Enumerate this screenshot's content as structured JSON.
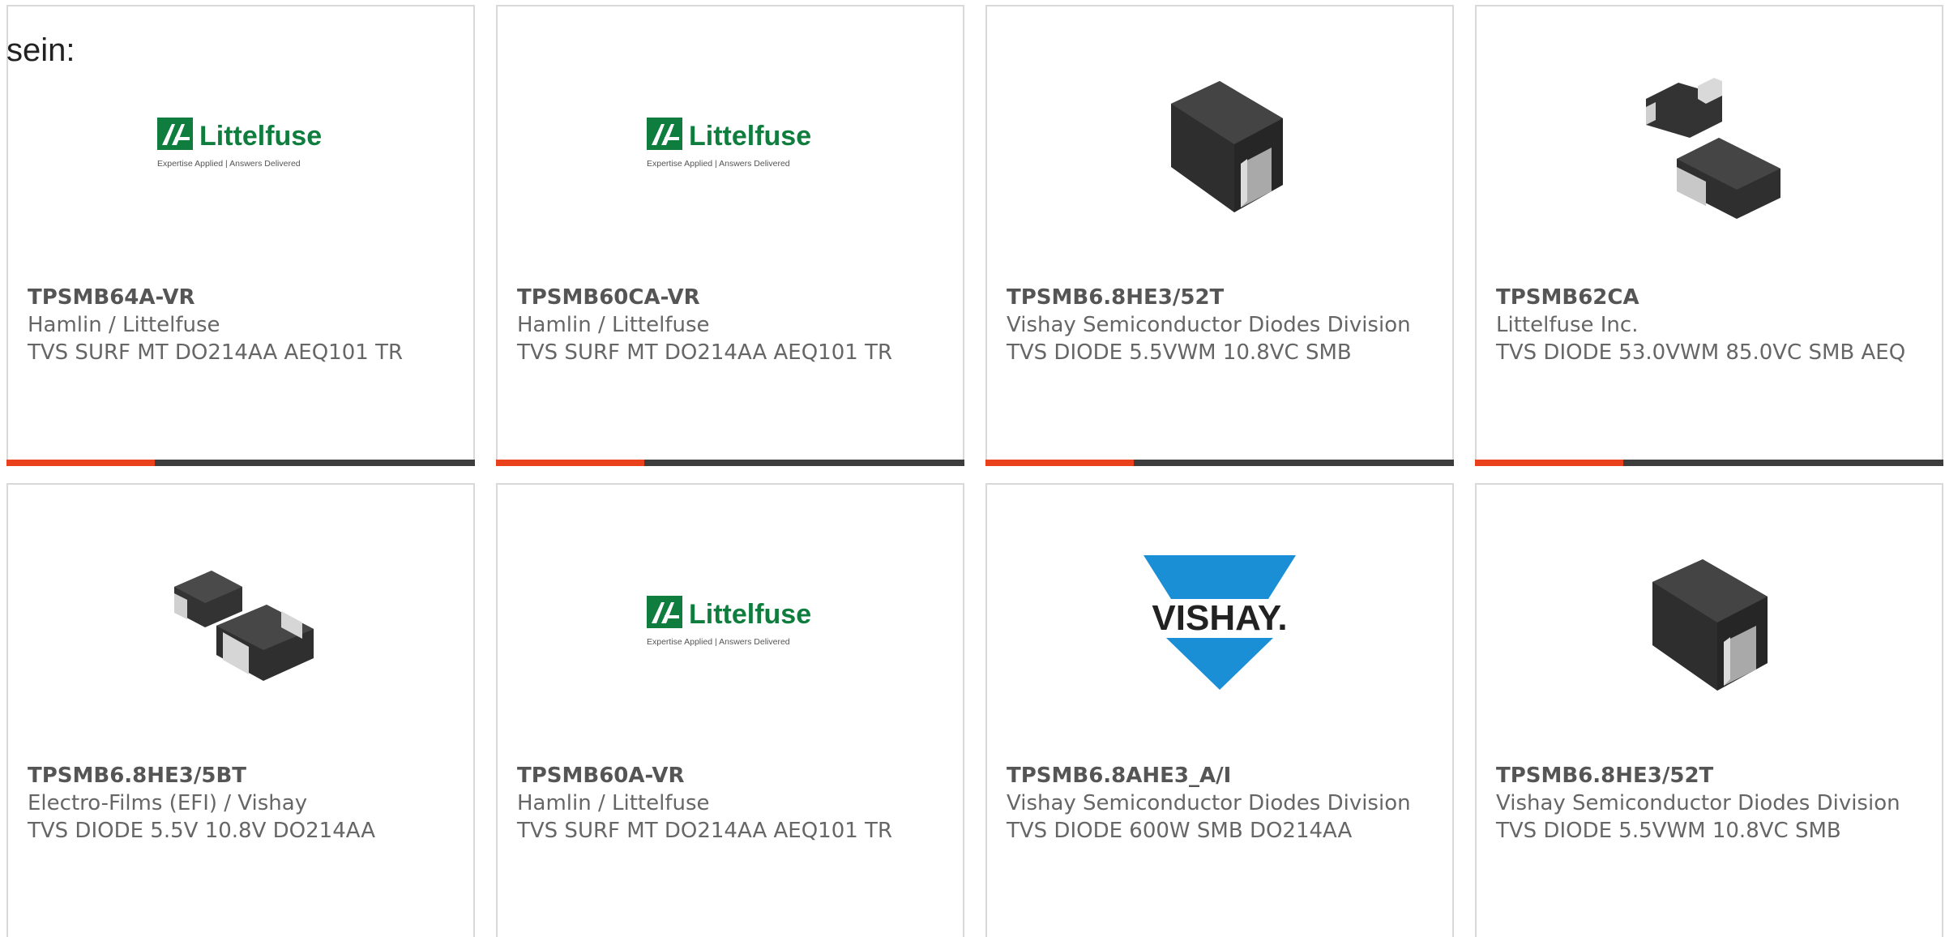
{
  "intro_text": "sein:",
  "colors": {
    "accent_orange": "#e8411b",
    "accent_dark": "#3d3d3d",
    "littelfuse_green": "#0f7d3e",
    "vishay_blue": "#1a8fd6"
  },
  "products": [
    {
      "part_number": "TPSMB64A-VR",
      "manufacturer": "Hamlin / Littelfuse",
      "description": "TVS SURF MT DO214AA AEQ101 TR",
      "image": "littelfuse-logo",
      "logo_text": "Littelfuse",
      "logo_tagline": "Expertise Applied | Answers Delivered"
    },
    {
      "part_number": "TPSMB60CA-VR",
      "manufacturer": "Hamlin / Littelfuse",
      "description": "TVS SURF MT DO214AA AEQ101 TR",
      "image": "littelfuse-logo",
      "logo_text": "Littelfuse",
      "logo_tagline": "Expertise Applied | Answers Delivered"
    },
    {
      "part_number": "TPSMB6.8HE3/52T",
      "manufacturer": "Vishay Semiconductor Diodes Division",
      "description": "TVS DIODE 5.5VWM 10.8VC SMB",
      "image": "smb-diode-package"
    },
    {
      "part_number": "TPSMB62CA",
      "manufacturer": "Littelfuse Inc.",
      "description": "TVS DIODE 53.0VWM 85.0VC SMB AEQ",
      "image": "smb-diode-pair"
    },
    {
      "part_number": "TPSMB6.8HE3/5BT",
      "manufacturer": "Electro-Films (EFI) / Vishay",
      "description": "TVS DIODE 5.5V 10.8V DO214AA",
      "image": "smb-diode-pair-flat"
    },
    {
      "part_number": "TPSMB60A-VR",
      "manufacturer": "Hamlin / Littelfuse",
      "description": "TVS SURF MT DO214AA AEQ101 TR",
      "image": "littelfuse-logo",
      "logo_text": "Littelfuse",
      "logo_tagline": "Expertise Applied | Answers Delivered"
    },
    {
      "part_number": "TPSMB6.8AHE3_A/I",
      "manufacturer": "Vishay Semiconductor Diodes Division",
      "description": "TVS DIODE 600W SMB DO214AA",
      "image": "vishay-logo",
      "logo_text": "VISHAY."
    },
    {
      "part_number": "TPSMB6.8HE3/52T",
      "manufacturer": "Vishay Semiconductor Diodes Division",
      "description": "TVS DIODE 5.5VWM 10.8VC SMB",
      "image": "smb-diode-package"
    }
  ]
}
